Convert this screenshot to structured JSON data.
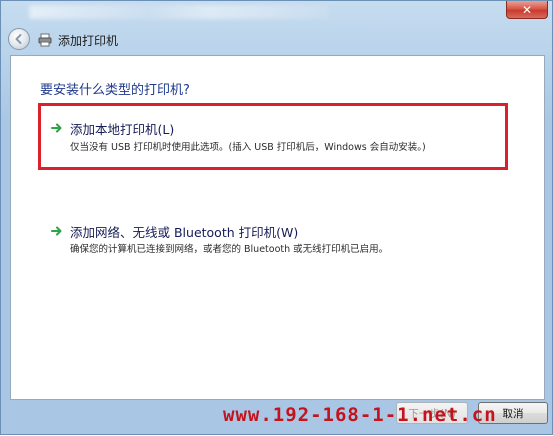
{
  "window": {
    "close_symbol": "✕",
    "nav_title": "添加打印机"
  },
  "main": {
    "heading": "要安装什么类型的打印机?",
    "options": [
      {
        "title": "添加本地打印机(L)",
        "description": "仅当没有 USB 打印机时使用此选项。(插入 USB 打印机后，Windows 会自动安装。)",
        "icon": "green-arrow-icon"
      },
      {
        "title": "添加网络、无线或 Bluetooth 打印机(W)",
        "description": "确保您的计算机已连接到网络，或者您的 Bluetooth 或无线打印机已启用。",
        "icon": "green-arrow-icon"
      }
    ]
  },
  "footer": {
    "watermark": "www.192-168-1-1.net.cn",
    "next_label": "下一步(N)",
    "cancel_label": "取消"
  },
  "colors": {
    "heading": "#1e3a8c",
    "highlight_border": "#d9202b",
    "watermark": "#c4131c",
    "arrow": "#2fa34a"
  }
}
